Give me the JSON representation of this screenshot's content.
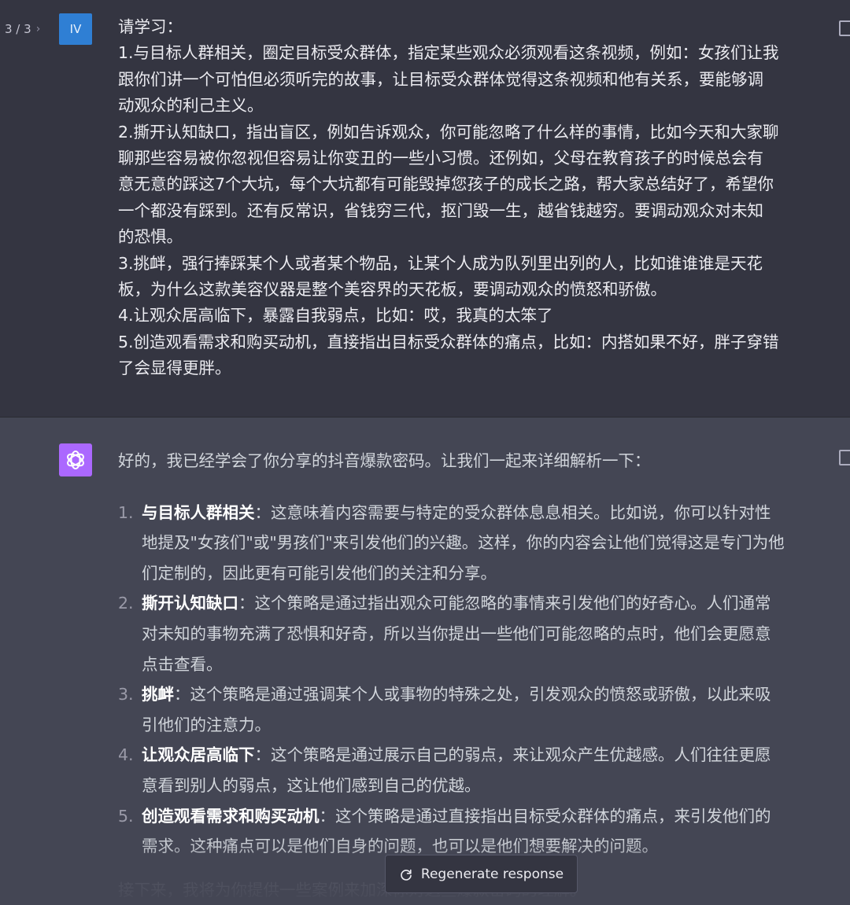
{
  "pager": {
    "label": "3 / 3",
    "next_symbol": "›"
  },
  "user": {
    "avatar_label": "IV",
    "lines": [
      "请学习：",
      "1.与目标人群相关，圈定目标受众群体，指定某些观众必须观看这条视频，例如：女孩们让我",
      "跟你们讲一个可怕但必须听完的故事，让目标受众群体觉得这条视频和他有关系，要能够调",
      "动观众的利己主义。",
      "2.撕开认知缺口，指出盲区，例如告诉观众，你可能忽略了什么样的事情，比如今天和大家聊",
      "聊那些容易被你忽视但容易让你变丑的一些小习惯。还例如，父母在教育孩子的时候总会有",
      "意无意的踩这7个大坑，每个大坑都有可能毁掉您孩子的成长之路，帮大家总结好了，希望你",
      "一个都没有踩到。还有反常识，省钱穷三代，抠门毁一生，越省钱越穷。要调动观众对未知",
      "的恐惧。",
      "3.挑衅，强行捧踩某个人或者某个物品，让某个人成为队列里出列的人，比如谁谁谁是天花",
      "板，为什么这款美容仪器是整个美容界的天花板，要调动观众的愤怒和骄傲。",
      "4.让观众居高临下，暴露自我弱点，比如：哎，我真的太笨了",
      "5.创造观看需求和购买动机，直接指出目标受众群体的痛点，比如：内搭如果不好，胖子穿错",
      "了会显得更胖。"
    ]
  },
  "assistant": {
    "avatar_icon": "openai-logo-icon",
    "intro": "好的，我已经学会了你分享的抖音爆款密码。让我们一起来详细解析一下：",
    "items": [
      {
        "num": "1.",
        "term": "与目标人群相关",
        "first": "：这意味着内容需要与特定的受众群体息息相关。比如说，你可以针对性",
        "rest": [
          "地提及\"女孩们\"或\"男孩们\"来引发他们的兴趣。这样，你的内容会让他们觉得这是专门为他",
          "们定制的，因此更有可能引发他们的关注和分享。"
        ]
      },
      {
        "num": "2.",
        "term": "撕开认知缺口",
        "first": "：这个策略是通过指出观众可能忽略的事情来引发他们的好奇心。人们通常",
        "rest": [
          "对未知的事物充满了恐惧和好奇，所以当你提出一些他们可能忽略的点时，他们会更愿意",
          "点击查看。"
        ]
      },
      {
        "num": "3.",
        "term": "挑衅",
        "first": "：这个策略是通过强调某个人或事物的特殊之处，引发观众的愤怒或骄傲，以此来吸",
        "rest": [
          "引他们的注意力。"
        ]
      },
      {
        "num": "4.",
        "term": "让观众居高临下",
        "first": "：这个策略是通过展示自己的弱点，来让观众产生优越感。人们往往更愿",
        "rest": [
          "意看到别人的弱点，这让他们感到自己的优越。"
        ]
      },
      {
        "num": "5.",
        "term": "创造观看需求和购买动机",
        "first": "：这个策略是通过直接指出目标受众群体的痛点，来引发他们的",
        "rest": [
          "需求。这种痛点可以是他们自身的问题，也可以是他们想要解决的问题。"
        ]
      }
    ],
    "tail": "接下来，我将为你提供一些案例来加深你对这些爆款密码的理解。"
  },
  "regenerate": {
    "label": "Regenerate response",
    "icon": "refresh-icon"
  },
  "colors": {
    "user_bg": "#343541",
    "assistant_bg": "#444654",
    "user_avatar": "#2f7fd4",
    "bot_avatar": "#ab68ff",
    "text": "#ececf1"
  }
}
